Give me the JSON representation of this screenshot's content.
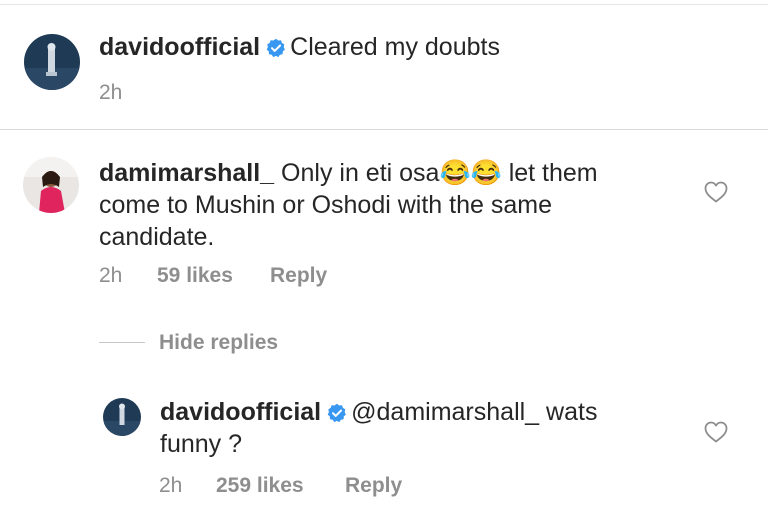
{
  "post": {
    "username": "davidoofficial",
    "caption": "Cleared my doubts",
    "time": "2h"
  },
  "comment": {
    "username": "damimarshall_",
    "text_before_emoji": "Only in eti osa",
    "emoji": "😂😂",
    "text_after_emoji": "let them",
    "text_line2": "come to Mushin or Oshodi with the same",
    "text_line3": "candidate.",
    "time": "2h",
    "likes": "59 likes",
    "reply_label": "Reply"
  },
  "replies_toggle": {
    "label": "Hide replies"
  },
  "reply": {
    "username": "davidoofficial",
    "mention": "@damimarshall_",
    "text_after_mention": "wats",
    "text_line2": "funny ?",
    "time": "2h",
    "likes": "259 likes",
    "reply_label": "Reply"
  },
  "colors": {
    "text": "#262626",
    "meta": "#8e8e8e",
    "verified": "#3897f0",
    "divider": "#dbdbdb"
  },
  "icons": {
    "verified": "verified-badge-icon",
    "heart": "heart-outline-icon"
  }
}
